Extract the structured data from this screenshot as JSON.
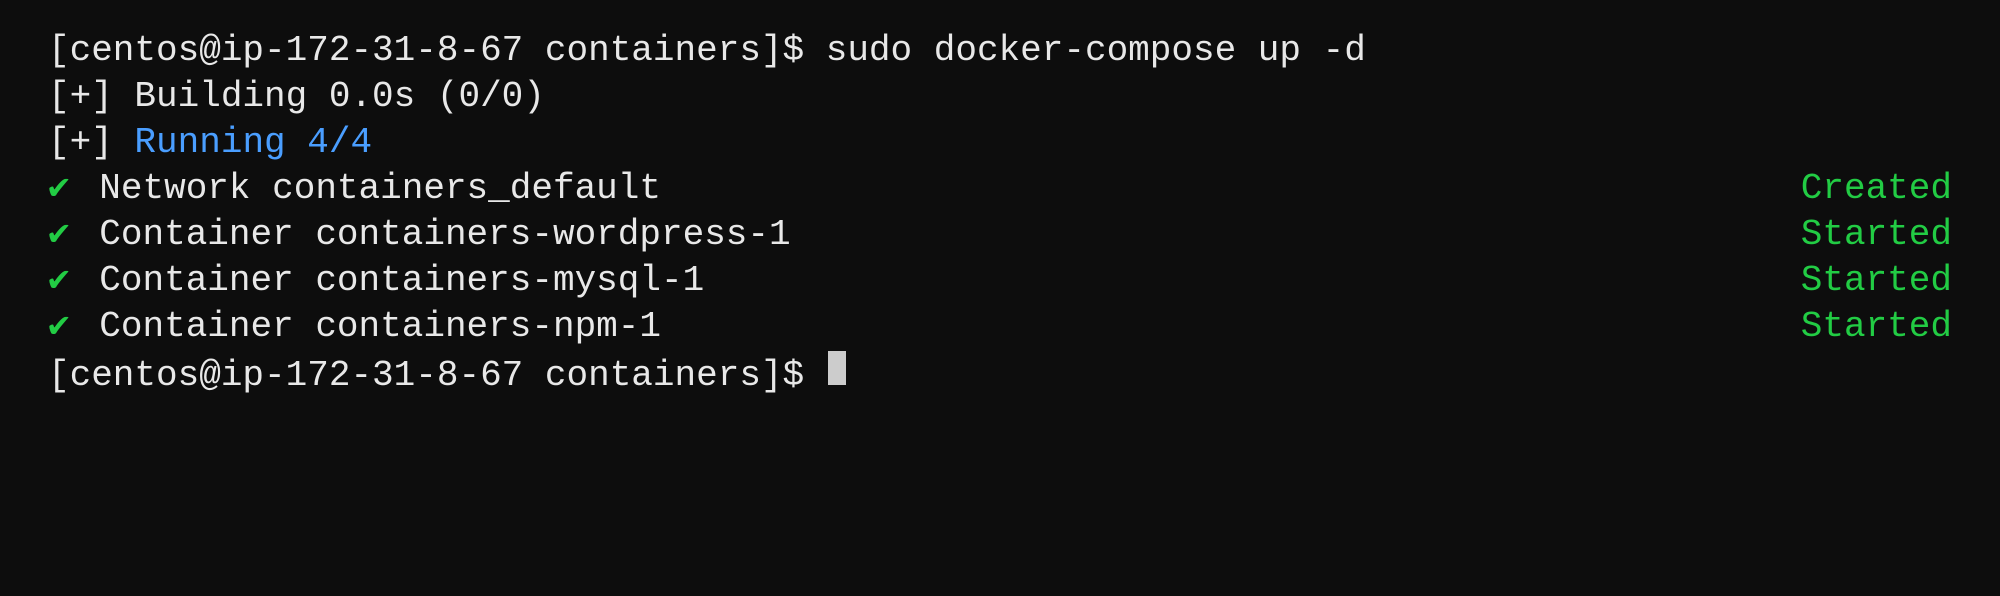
{
  "terminal": {
    "background": "#0d0d0d",
    "lines": {
      "command": "[centos@ip-172-31-8-67 containers]$ sudo docker-compose up -d",
      "building": "[+] Building 0.0s (0/0)",
      "running": "[+] Running 4/4",
      "network_check": "✔",
      "network_name": " Network containers_default",
      "network_status": "Created",
      "container1_check": "✔",
      "container1_name": " Container containers-wordpress-1",
      "container1_status": "Started",
      "container2_check": "✔",
      "container2_name": " Container containers-mysql-1",
      "container2_status": "Started",
      "container3_check": "✔",
      "container3_name": " Container containers-npm-1",
      "container3_status": "Started",
      "prompt": "[centos@ip-172-31-8-67 containers]$ "
    }
  }
}
